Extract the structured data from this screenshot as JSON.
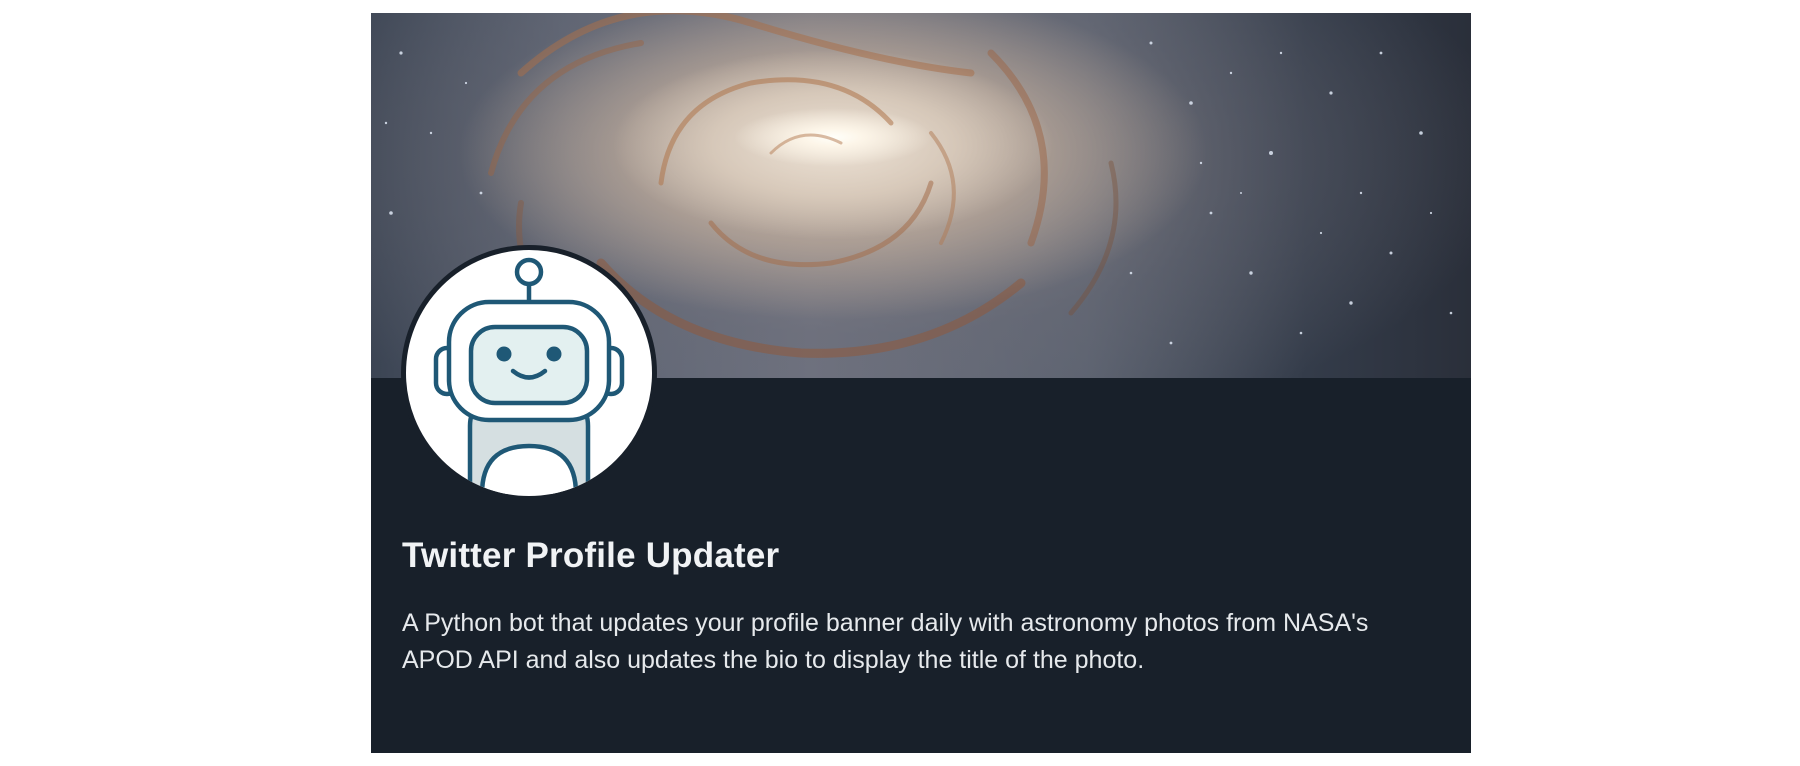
{
  "profile": {
    "title": "Twitter Profile Updater",
    "description": "A Python bot that updates your profile banner daily with astronomy photos from NASA's APOD API and also updates the bio to display the title of the photo."
  },
  "banner": {
    "image": "galaxy-photo"
  },
  "avatar": {
    "icon": "robot-icon"
  },
  "colors": {
    "card_background": "#18202a",
    "title_text": "#f1f3f5",
    "description_text": "#e6e9ec",
    "robot_stroke": "#1f5876",
    "robot_face_fill": "#e3f0f0",
    "robot_body_fill": "#d5dfe1"
  }
}
